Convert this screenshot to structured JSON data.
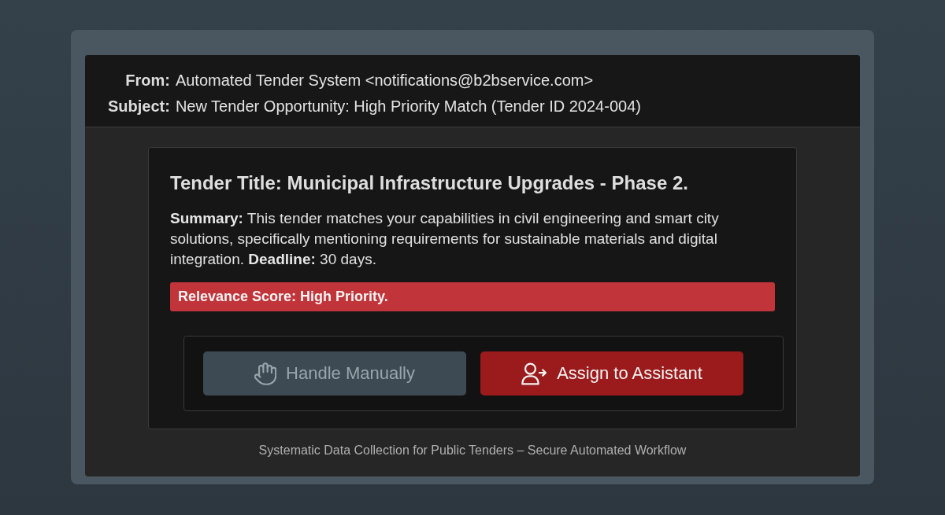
{
  "email_header": {
    "fields": [
      {
        "label": "From:",
        "value": "Automated Tender System <notifications@b2bservice.com>"
      },
      {
        "label": "Subject:",
        "value": "New Tender Opportunity: High Priority Match (Tender ID 2024-004)"
      }
    ]
  },
  "tender_card": {
    "title": "Tender Title: Municipal Infrastructure Upgrades - Phase 2.",
    "summary": "**Summary:** This tender matches your capabilities in civil engineering and smart city solutions, specifically mentioning requirements for sustainable materials and digital integration. **Deadline:** 30 days.",
    "relevance_banner": "Relevance Score: High Priority.",
    "actions": [
      {
        "label": "Handle Manually",
        "kind": "secondary"
      },
      {
        "label": "Assign to Assistant",
        "kind": "primary"
      }
    ]
  },
  "footer": "Systematic Data Collection for Public Tenders – Secure Automated Workflow"
}
